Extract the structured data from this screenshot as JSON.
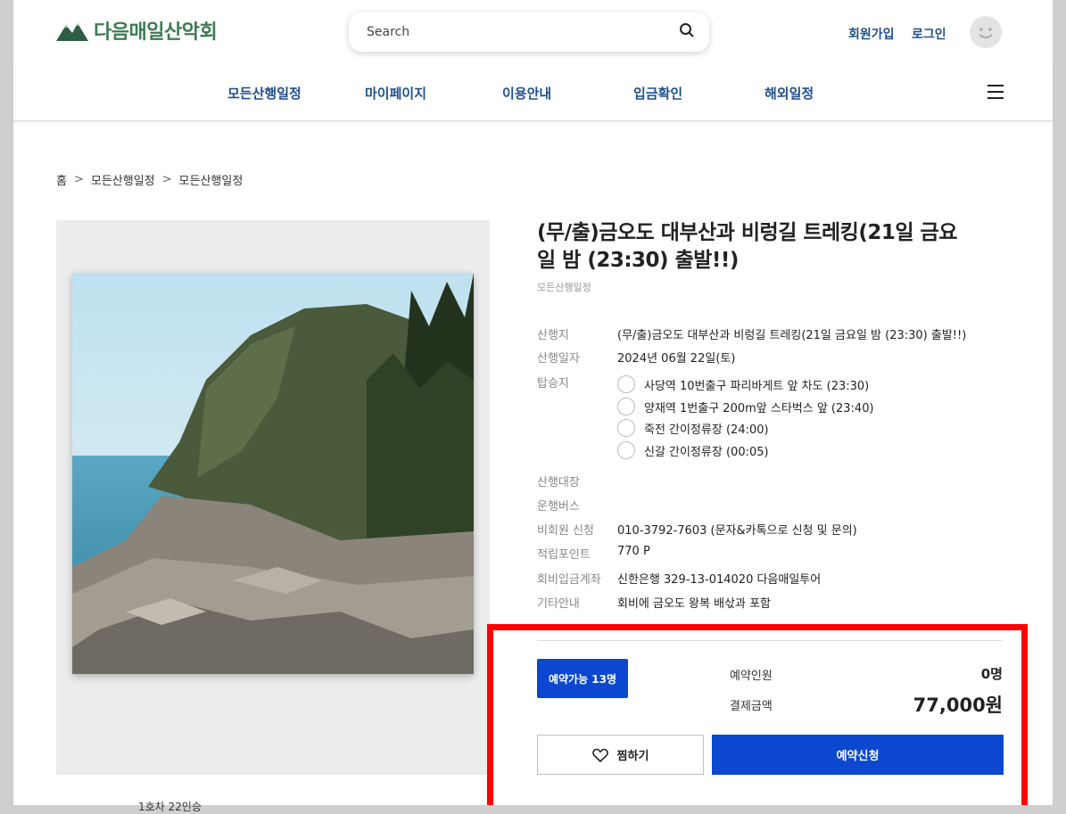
{
  "header": {
    "logo_text": "다음매일산악회",
    "search_placeholder": "Search",
    "signup": "회원가입",
    "login": "로그인"
  },
  "nav": {
    "items": [
      "모든산행일정",
      "마이페이지",
      "이용안내",
      "입금확인",
      "해외일정"
    ]
  },
  "breadcrumb": [
    "홈",
    "모든산행일정",
    "모든산행일정"
  ],
  "breadcrumb_sep": ">",
  "product": {
    "title": "(무/출)금오도 대부산과 비렁길 트레킹(21일 금요일 밤 (23:30) 출발!!)",
    "category": "모든산행일정",
    "info": [
      {
        "label": "산행지",
        "value": "(무/출)금오도 대부산과 비렁길 트레킹(21일 금요일 밤 (23:30) 출발!!)"
      },
      {
        "label": "산행일자",
        "value": "2024년 06월 22일(토)"
      },
      {
        "label": "탑승지",
        "value": ""
      },
      {
        "label": "산행대장",
        "value": ""
      },
      {
        "label": "운행버스",
        "value": ""
      },
      {
        "label": "비회원 신청",
        "value": "010-3792-7603 (문자&카톡으로 신청 및 문의)"
      },
      {
        "label": "적립포인트",
        "value": "770 P"
      },
      {
        "label": "회비입금계좌",
        "value": "신한은행 329-13-014020 다음매일투어"
      },
      {
        "label": "기타안내",
        "value": "회비에 금오도 왕복 배삯과 포함"
      }
    ],
    "boarding": [
      "사당역 10번출구 파리바게트 앞 차도 (23:30)",
      "양재역 1번출구 200m앞 스타벅스 앞 (23:40)",
      "죽전 간이정류장 (24:00)",
      "신갈 간이정류장 (00:05)"
    ]
  },
  "booking": {
    "available": "예약가능 13명",
    "people_label": "예약인원",
    "people_value": "0명",
    "price_label": "결제금액",
    "price_value": "77,000원",
    "wish": "찜하기",
    "reserve": "예약신청"
  },
  "footer_cut": "1호차 22인승",
  "colors": {
    "primary": "#0b47cf",
    "nav_text": "#1f4f8e",
    "logo_green": "#3e7b52",
    "highlight": "#ff0000"
  }
}
